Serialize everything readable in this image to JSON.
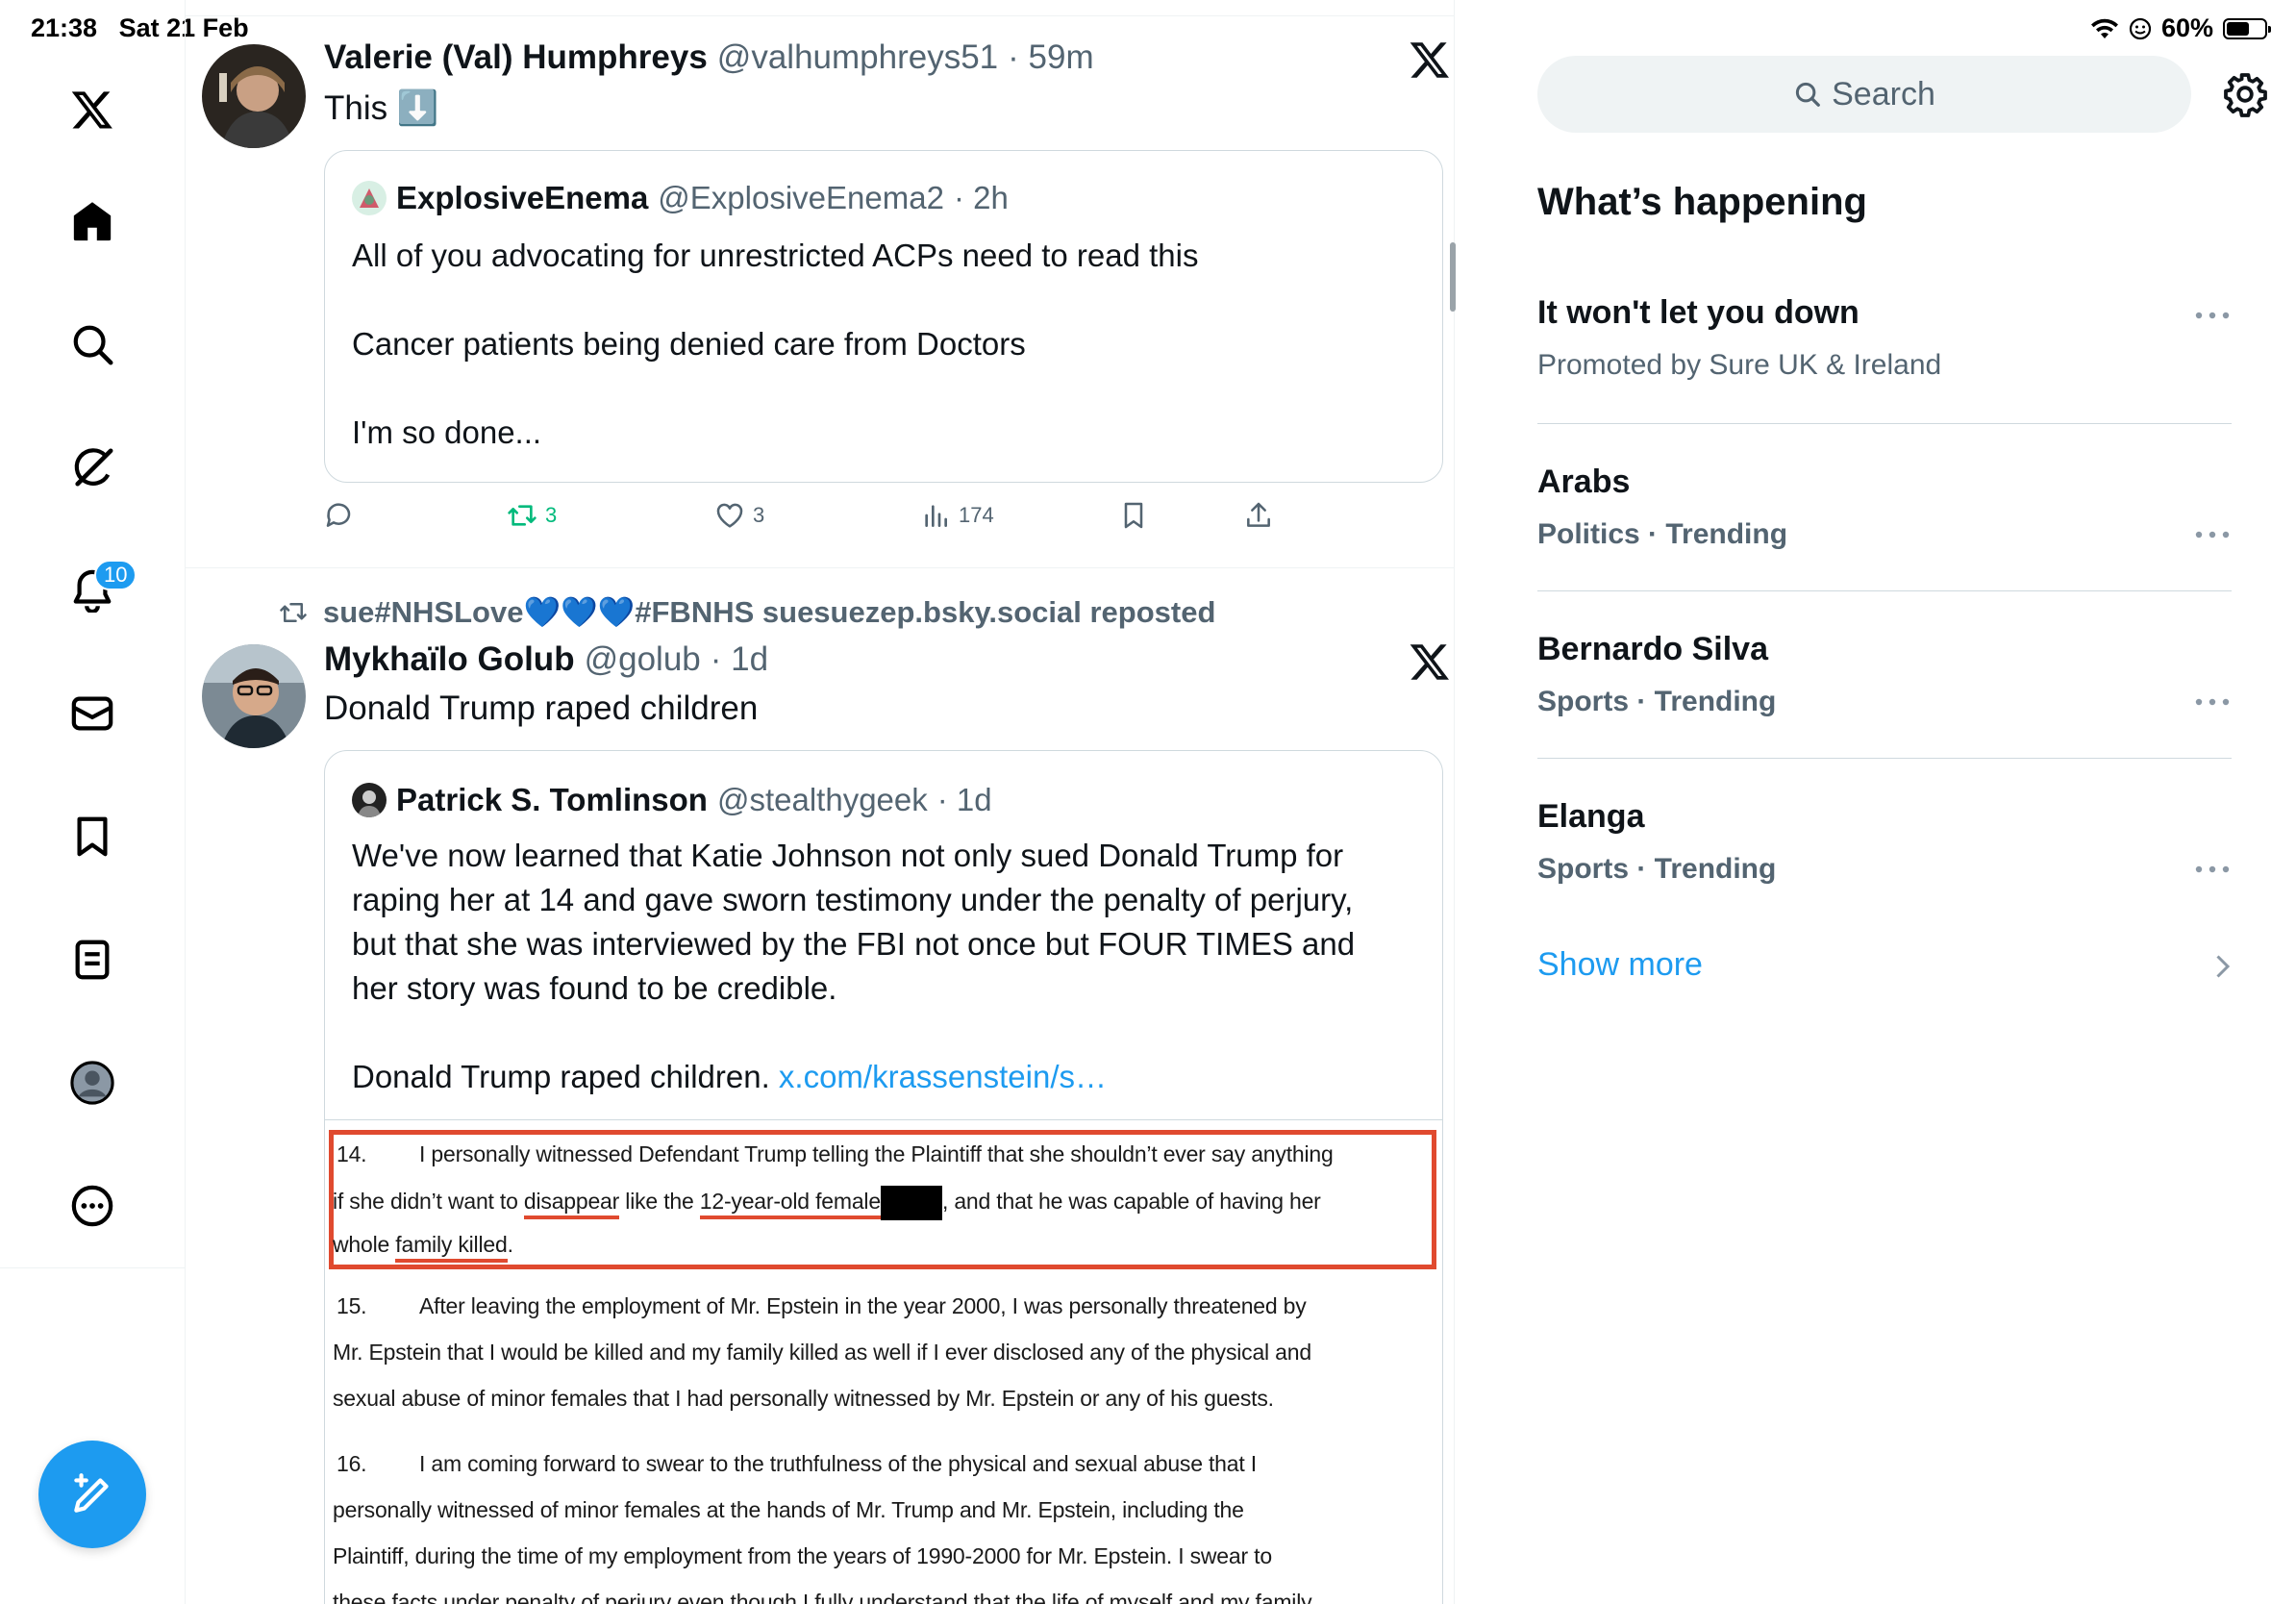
{
  "status_bar": {
    "time": "21:38",
    "date": "Sat 21 Feb",
    "battery": "60%",
    "battery_level": 0.6
  },
  "nav": {
    "items": [
      {
        "name": "x-logo-icon"
      },
      {
        "name": "home-icon"
      },
      {
        "name": "explore-icon"
      },
      {
        "name": "grok-icon"
      },
      {
        "name": "notifications-icon"
      },
      {
        "name": "messages-icon"
      },
      {
        "name": "bookmarks-icon"
      },
      {
        "name": "lists-icon"
      },
      {
        "name": "profile-icon"
      },
      {
        "name": "more-icon"
      }
    ],
    "notifications_badge": "10",
    "compose_icon": "compose-icon"
  },
  "timeline": {
    "tweet1": {
      "name": "Valerie (Val) Humphreys",
      "handle": "@valhumphreys51",
      "time": "· 59m",
      "text": "This ⬇️",
      "quote": {
        "name": "ExplosiveEnema",
        "handle": "@ExplosiveEnema2",
        "time": "· 2h",
        "text": "All of you advocating for unrestricted ACPs need to read this\n\nCancer patients being denied care from Doctors\n\nI'm so done..."
      },
      "actions": {
        "retweets": "3",
        "likes": "3",
        "views": "174"
      }
    },
    "repost_line": "sue#NHSLove💙💙💙#FBNHS suesuezep.bsky.social reposted",
    "tweet2": {
      "name": "Mykhaïlo Golub",
      "handle": "@golub",
      "time": "· 1d",
      "text": "Donald Trump raped children",
      "quote": {
        "name": "Patrick S. Tomlinson",
        "handle": "@stealthygeek",
        "time": "· 1d",
        "text": "We've now learned that Katie Johnson not only sued Donald Trump for\nraping her at 14 and gave sworn testimony under the penalty of perjury,\nbut that she was interviewed by the FBI not once but FOUR TIMES and\nher story was found to be credible.\n\nDonald Trump raped children. ",
        "link": "x.com/krassenstein/s…",
        "document": {
          "p14_num": "14.",
          "p14_l1": "I personally witnessed Defendant Trump telling the Plaintiff that she shouldn’t ever say anything",
          "p14_l2a": "if she didn’t want to ",
          "p14_l2b": "disappear",
          "p14_l2c": " like the ",
          "p14_l2d": "12-year-old female",
          "p14_l2e": ", and that he was capable of having her",
          "p14_l3a": "whole ",
          "p14_l3b": "family killed",
          "p14_l3c": ".",
          "p15_num": "15.",
          "p15_l1": "After leaving the employment of Mr. Epstein in the year 2000, I was personally threatened by",
          "p15_l2": "Mr. Epstein that I would be killed and my family killed as well if I ever disclosed any of the physical and",
          "p15_l3": "sexual abuse of minor females that I had personally witnessed by Mr. Epstein or any of his guests.",
          "p16_num": "16.",
          "p16_l1": "I am coming forward to swear to the truthfulness of the physical and sexual abuse that I",
          "p16_l2": "personally witnessed of minor females at the hands of Mr. Trump and Mr. Epstein, including the",
          "p16_l3": "Plaintiff, during the time of my employment from the years of 1990-2000 for Mr. Epstein.  I swear to",
          "p16_l4": "these facts under penalty of perjury even though I fully understand that the life of myself and my family"
        }
      }
    }
  },
  "right": {
    "search_placeholder": "Search",
    "title": "What’s happening",
    "trends": [
      {
        "name": "It won't let you down",
        "meta": "Promoted by Sure UK & Ireland"
      },
      {
        "name": "Arabs",
        "meta": "Politics · Trending"
      },
      {
        "name": "Bernardo Silva",
        "meta": "Sports · Trending"
      },
      {
        "name": "Elanga",
        "meta": "Sports · Trending"
      }
    ],
    "show_more": "Show more"
  },
  "colors": {
    "accent": "#1d9bf0",
    "retweet": "#00ba7c",
    "secondary_text": "#536471",
    "highlight_box": "#e04a2f"
  }
}
